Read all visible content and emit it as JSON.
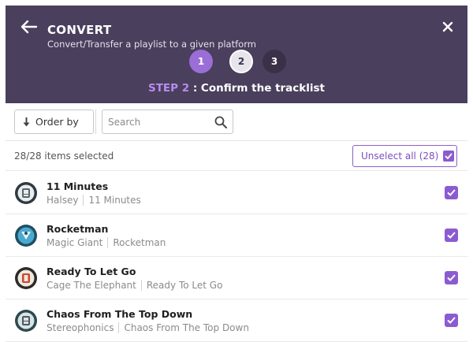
{
  "header": {
    "title": "CONVERT",
    "subtitle": "Convert/Transfer a playlist to a given platform",
    "steps": [
      {
        "label": "1",
        "state": "done"
      },
      {
        "label": "2",
        "state": "current"
      },
      {
        "label": "3",
        "state": "upcoming"
      }
    ],
    "step_prefix": "STEP 2",
    "step_caption": " : Confirm the tracklist",
    "icons": {
      "back": "arrow-left-icon",
      "close": "close-icon"
    }
  },
  "toolbar": {
    "order_label": "Order by",
    "order_icon": "arrow-down-icon",
    "search_placeholder": "Search",
    "search_value": "",
    "search_icon": "search-icon"
  },
  "selection": {
    "count_text": "28/28 items selected",
    "unselect_label": "Unselect all (28)",
    "unselect_checked": true
  },
  "tracks": [
    {
      "title": "11 Minutes",
      "artist": "Halsey",
      "album": "11 Minutes",
      "checked": true
    },
    {
      "title": "Rocketman",
      "artist": "Magic Giant",
      "album": "Rocketman",
      "checked": true
    },
    {
      "title": "Ready To Let Go",
      "artist": "Cage The Elephant",
      "album": "Ready To Let Go",
      "checked": true
    },
    {
      "title": "Chaos From The Top Down",
      "artist": "Stereophonics",
      "album": "Chaos From The Top Down",
      "checked": true
    }
  ],
  "colors": {
    "header_bg": "#4a3f5c",
    "accent": "#8b5cd0",
    "step_active": "#9b6dd6"
  }
}
